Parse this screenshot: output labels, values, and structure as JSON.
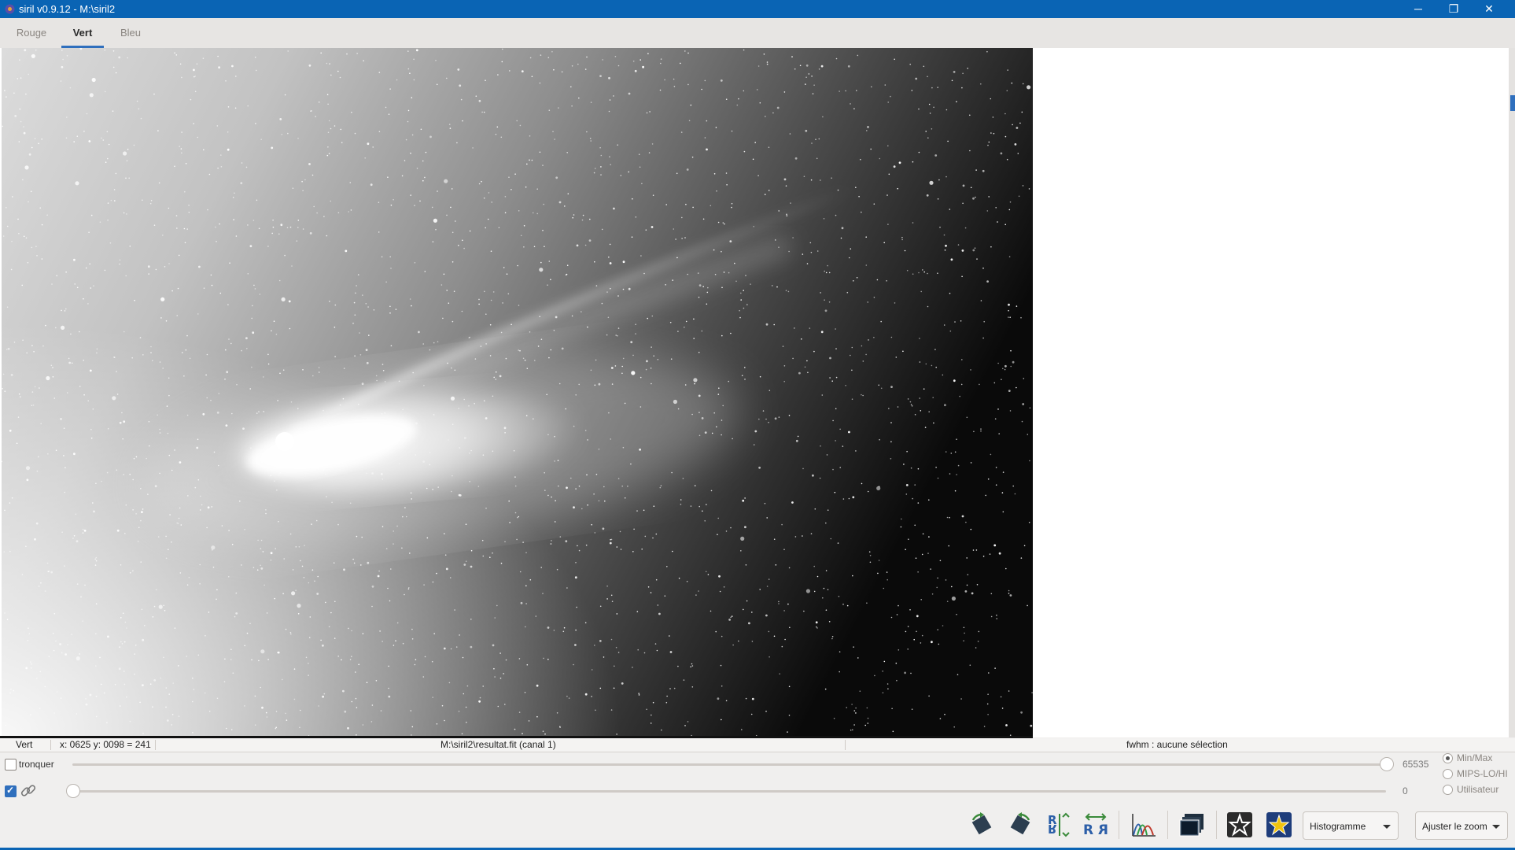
{
  "window": {
    "title": "siril v0.9.12 - M:\\siril2",
    "minimize_glyph": "─",
    "restore_glyph": "❐",
    "close_glyph": "✕"
  },
  "tabs": [
    {
      "label": "Rouge",
      "active": false
    },
    {
      "label": "Vert",
      "active": true
    },
    {
      "label": "Bleu",
      "active": false
    }
  ],
  "status": {
    "channel": "Vert",
    "coords": "x: 0625 y: 0098 = 241",
    "file": "M:\\siril2\\resultat.fit (canal 1)",
    "fwhm": "fwhm : aucune sélection"
  },
  "controls": {
    "tronquer_label": "tronquer",
    "tronquer_checked": false,
    "link_checked": true,
    "high_value": "65535",
    "low_value": "0",
    "high_level": 1.0,
    "low_level": 0.0,
    "scale_options": [
      {
        "label": "Min/Max",
        "selected": true
      },
      {
        "label": "MIPS-LO/HI",
        "selected": false
      },
      {
        "label": "Utilisateur",
        "selected": false
      }
    ]
  },
  "toolbar": {
    "buttons": [
      "rotate-left-icon",
      "rotate-right-icon",
      "mirror-vertical-icon",
      "mirror-horizontal-icon",
      "histogram-icon",
      "image-layers-icon",
      "star-list-icon",
      "photometry-star-icon"
    ],
    "display_mode": "Histogramme",
    "zoom": "Ajuster le zoom"
  },
  "image": {
    "subject": "comet-image",
    "mode": "grayscale"
  }
}
